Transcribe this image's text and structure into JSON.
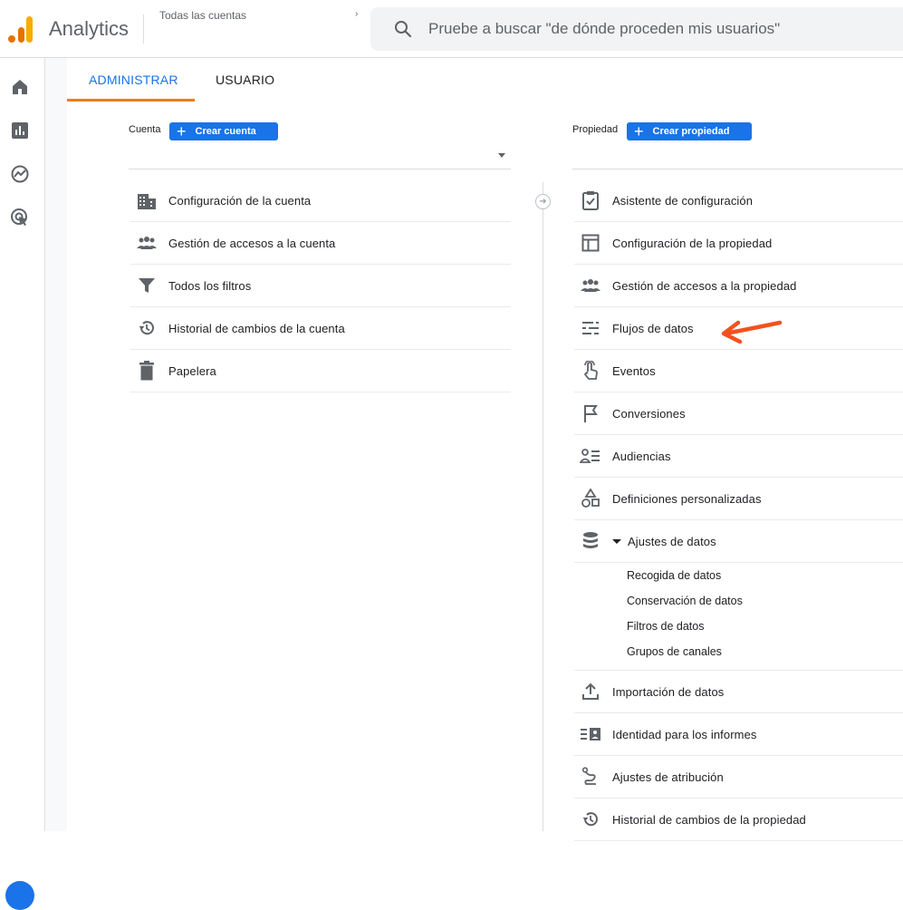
{
  "app": {
    "name": "Analytics"
  },
  "account_picker": {
    "label": "Todas las cuentas",
    "suffix": "›"
  },
  "search": {
    "placeholder": "Pruebe a buscar \"de dónde proceden mis usuarios\""
  },
  "rail": {
    "items": [
      "home-icon",
      "reports-icon",
      "explore-icon",
      "advertising-icon"
    ]
  },
  "tabs": [
    {
      "label": "ADMINISTRAR",
      "active": true
    },
    {
      "label": "USUARIO",
      "active": false
    }
  ],
  "account": {
    "label": "Cuenta",
    "create_label": "Crear cuenta",
    "items": [
      {
        "label": "Configuración de la cuenta",
        "icon": "building-icon"
      },
      {
        "label": "Gestión de accesos a la cuenta",
        "icon": "people-icon"
      },
      {
        "label": "Todos los filtros",
        "icon": "filter-icon"
      },
      {
        "label": "Historial de cambios de la cuenta",
        "icon": "history-icon"
      },
      {
        "label": "Papelera",
        "icon": "trash-icon"
      }
    ]
  },
  "property": {
    "label": "Propiedad",
    "create_label": "Crear propiedad",
    "items": [
      {
        "label": "Asistente de configuración",
        "icon": "checklist-icon"
      },
      {
        "label": "Configuración de la propiedad",
        "icon": "layout-icon"
      },
      {
        "label": "Gestión de accesos a la propiedad",
        "icon": "people-icon"
      },
      {
        "label": "Flujos de datos",
        "icon": "streams-icon"
      },
      {
        "label": "Eventos",
        "icon": "touch-icon"
      },
      {
        "label": "Conversiones",
        "icon": "flag-icon"
      },
      {
        "label": "Audiencias",
        "icon": "audience-icon"
      },
      {
        "label": "Definiciones personalizadas",
        "icon": "shapes-icon"
      },
      {
        "label": "Ajustes de datos",
        "icon": "database-icon"
      }
    ],
    "data_settings_sub": [
      "Recogida de datos",
      "Conservación de datos",
      "Filtros de datos",
      "Grupos de canales"
    ],
    "items_after": [
      {
        "label": "Importación de datos",
        "icon": "upload-icon"
      },
      {
        "label": "Identidad para los informes",
        "icon": "identity-icon"
      },
      {
        "label": "Ajustes de atribución",
        "icon": "attribution-icon"
      },
      {
        "label": "Historial de cambios de la propiedad",
        "icon": "history-icon"
      }
    ]
  },
  "colors": {
    "accent": "#1a73e8",
    "tab_underline": "#f57c00",
    "annotation_arrow": "#f4511e"
  }
}
